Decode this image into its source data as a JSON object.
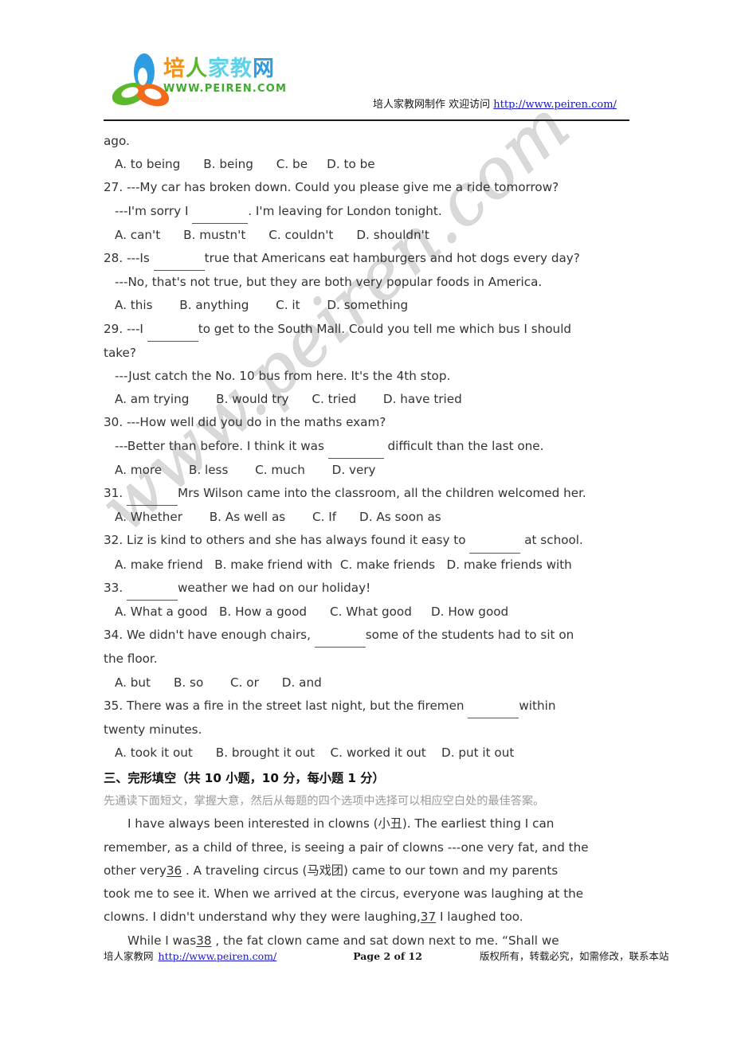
{
  "header": {
    "logo": {
      "mark_name": "peiren-trefoil-logo",
      "colors": {
        "blue": "#2e9ce0",
        "green": "#5bb82a",
        "orange": "#f26a1b",
        "cyan": "#5fd2e8"
      },
      "cn_chars": [
        {
          "ch": "培",
          "color": "#f2921b"
        },
        {
          "ch": "人",
          "color": "#5bb82a"
        },
        {
          "ch": "家",
          "color": "#5fd2e8"
        },
        {
          "ch": "教",
          "color": "#5fd2e8"
        },
        {
          "ch": "网",
          "color": "#2e9ce0"
        }
      ],
      "url_text": "WWW.PEIREN.COM"
    },
    "note_text": "培人家教网制作 欢迎访问 ",
    "note_link": "http://www.peiren.com/"
  },
  "body_lines": [
    {
      "kind": "line",
      "indent": "none",
      "text": "ago."
    },
    {
      "kind": "line",
      "indent": "opt",
      "text": "A. to being      B. being      C. be     D. to be"
    },
    {
      "kind": "line",
      "indent": "none",
      "text": "27. ---My car has broken down. Could you please give me a ride tomorrow?"
    },
    {
      "kind": "blank-line",
      "indent": "sub",
      "before": "---I'm sorry I ",
      "after": ". I'm leaving for London tonight.",
      "blank": "w2"
    },
    {
      "kind": "line",
      "indent": "opt",
      "text": "A. can't      B. mustn't      C. couldn't      D. shouldn't"
    },
    {
      "kind": "blank-line",
      "indent": "none",
      "before": "28. ---Is ",
      "after": "true that Americans eat hamburgers and hot dogs every day?",
      "blank": "w1"
    },
    {
      "kind": "line",
      "indent": "sub",
      "text": "---No, that's not true, but they are both very popular foods in America."
    },
    {
      "kind": "line",
      "indent": "opt",
      "text": "A. this       B. anything       C. it       D. something"
    },
    {
      "kind": "blank-line",
      "indent": "none",
      "before": "29. ---I ",
      "after": "to get to the South Mall. Could you tell me which bus I should",
      "blank": "w1"
    },
    {
      "kind": "line",
      "indent": "none",
      "text": "take?"
    },
    {
      "kind": "line",
      "indent": "sub",
      "text": "---Just catch the No. 10 bus from here. It's the 4th stop."
    },
    {
      "kind": "line",
      "indent": "opt",
      "text": "A. am trying       B. would try      C. tried       D. have tried"
    },
    {
      "kind": "line",
      "indent": "none",
      "text": "30. ---How well did you do in the maths exam?"
    },
    {
      "kind": "blank-line",
      "indent": "sub",
      "before": "---Better than before. I think it was ",
      "after": " difficult than the last one.",
      "blank": "w2"
    },
    {
      "kind": "line",
      "indent": "opt",
      "text": "A. more       B. less       C. much       D. very"
    },
    {
      "kind": "blank-line",
      "indent": "none",
      "before": "31. ",
      "after": "Mrs Wilson came into the classroom, all the children welcomed her.",
      "blank": "w1"
    },
    {
      "kind": "line",
      "indent": "opt",
      "text": "A. Whether       B. As well as       C. If      D. As soon as"
    },
    {
      "kind": "blank-line",
      "indent": "none",
      "before": "32. Liz is kind to others and she has always found it easy to ",
      "after": " at school.",
      "blank": "w1"
    },
    {
      "kind": "line",
      "indent": "opt",
      "text": "A. make friend   B. make friend with  C. make friends   D. make friends with"
    },
    {
      "kind": "blank-line",
      "indent": "none",
      "before": "33. ",
      "after": "weather we had on our holiday!",
      "blank": "w1"
    },
    {
      "kind": "line",
      "indent": "opt",
      "text": "A. What a good   B. How a good      C. What good     D. How good"
    },
    {
      "kind": "blank-line",
      "indent": "none",
      "before": "34. We didn't have enough chairs, ",
      "after": "some of the students had to sit on",
      "blank": "w1"
    },
    {
      "kind": "line",
      "indent": "none",
      "text": "the floor."
    },
    {
      "kind": "line",
      "indent": "opt",
      "text": "A. but      B. so       C. or      D. and"
    },
    {
      "kind": "blank-line",
      "indent": "none",
      "before": "35. There was a fire in the street last night, but the firemen ",
      "after": "within",
      "blank": "w1"
    },
    {
      "kind": "line",
      "indent": "none",
      "text": "twenty minutes."
    },
    {
      "kind": "line",
      "indent": "opt",
      "text": "A. took it out      B. brought it out    C. worked it out    D. put it out"
    }
  ],
  "section": {
    "heading": "三、完形填空（共 10 小题，10 分，每小题 1 分）",
    "instruction": "先通读下面短文，掌握大意，然后从每题的四个选项中选择可以相应空白处的最佳答案。"
  },
  "passage_lines": [
    {
      "first": true,
      "parts": [
        {
          "t": "I have always been interested in clowns (小丑). The earliest thing I can"
        }
      ]
    },
    {
      "first": false,
      "parts": [
        {
          "t": "remember, as a child of three, is seeing a pair of clowns ---one very fat, and the"
        }
      ]
    },
    {
      "first": false,
      "parts": [
        {
          "t": "other very"
        },
        {
          "blank_num": "36"
        },
        {
          "t": " . A traveling circus (马戏团) came to our town and my parents"
        }
      ]
    },
    {
      "first": false,
      "parts": [
        {
          "t": "took me to see it. When we arrived at the circus, everyone was laughing at the"
        }
      ]
    },
    {
      "first": false,
      "parts": [
        {
          "t": "clowns. I didn't understand why they were laughing,"
        },
        {
          "blank_num": "37"
        },
        {
          "t": " I laughed too."
        }
      ]
    },
    {
      "first": true,
      "parts": [
        {
          "t": "While I was"
        },
        {
          "blank_num": "38"
        },
        {
          "t": " , the fat clown came and sat down next to me. “Shall we"
        }
      ]
    }
  ],
  "watermark": "www.peiren.com",
  "footer": {
    "site": "培人家教网",
    "link": "http://www.peiren.com/",
    "page": "Page 2 of 12",
    "copyright": "版权所有，转载必究，如需修改，联系本站"
  }
}
